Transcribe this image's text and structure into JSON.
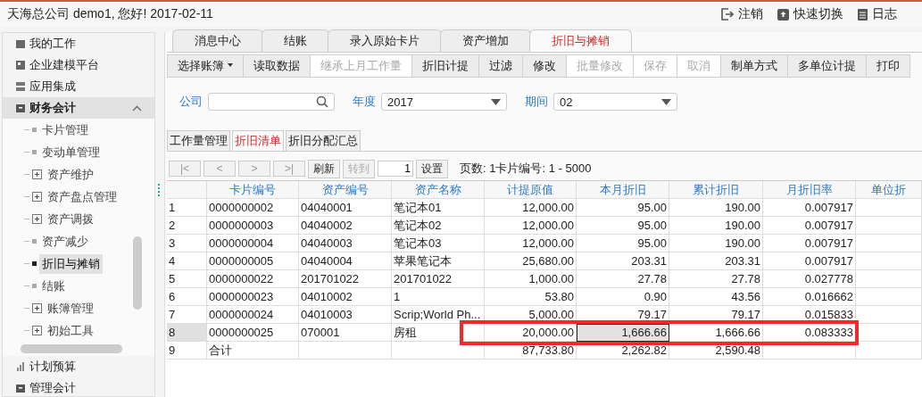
{
  "header": {
    "title": "天海总公司 demo1, 您好! 2017-02-11",
    "actions": [
      {
        "kind": "logout",
        "label": "注销"
      },
      {
        "kind": "switch",
        "label": "快速切换"
      },
      {
        "kind": "log",
        "label": "日志"
      }
    ]
  },
  "sidebar": {
    "items": [
      {
        "label": "我的工作",
        "expanded": false
      },
      {
        "label": "企业建模平台",
        "expanded": false
      },
      {
        "label": "应用集成",
        "expanded": false
      },
      {
        "label": "财务会计",
        "expanded": true,
        "children": [
          {
            "kind": "page",
            "label": "卡片管理",
            "selected": false
          },
          {
            "kind": "page",
            "label": "变动单管理",
            "selected": false
          },
          {
            "kind": "folder",
            "label": "资产维护",
            "selected": false
          },
          {
            "kind": "folder",
            "label": "资产盘点管理",
            "selected": false
          },
          {
            "kind": "folder",
            "label": "资产调拨",
            "selected": false
          },
          {
            "kind": "page",
            "label": "资产减少",
            "selected": false
          },
          {
            "kind": "page",
            "label": "折旧与摊销",
            "selected": true
          },
          {
            "kind": "page",
            "label": "结账",
            "selected": false
          },
          {
            "kind": "folder",
            "label": "账簿管理",
            "selected": false
          },
          {
            "kind": "folder",
            "label": "初始工具",
            "selected": false
          }
        ]
      },
      {
        "label": "计划预算",
        "expanded": false
      },
      {
        "label": "管理会计",
        "expanded": false
      }
    ]
  },
  "tabs": [
    {
      "label": "消息中心",
      "selected": false
    },
    {
      "label": "结账",
      "selected": false
    },
    {
      "label": "录入原始卡片",
      "selected": false
    },
    {
      "label": "资产增加",
      "selected": false
    },
    {
      "label": "折旧与摊销",
      "selected": true
    }
  ],
  "toolbar": [
    {
      "kind": "dropdown",
      "label": "选择账簿",
      "disabled": false
    },
    {
      "kind": "button",
      "label": "读取数据",
      "disabled": false
    },
    {
      "kind": "button",
      "label": "继承上月工作量",
      "disabled": true
    },
    {
      "kind": "button",
      "label": "折旧计提",
      "disabled": false
    },
    {
      "kind": "button",
      "label": "过滤",
      "disabled": false
    },
    {
      "kind": "button",
      "label": "修改",
      "disabled": false
    },
    {
      "kind": "button",
      "label": "批量修改",
      "disabled": true
    },
    {
      "kind": "button",
      "label": "保存",
      "disabled": true
    },
    {
      "kind": "button",
      "label": "取消",
      "disabled": true
    },
    {
      "kind": "button",
      "label": "制单方式",
      "disabled": false
    },
    {
      "kind": "button",
      "label": "多单位计提",
      "disabled": false
    },
    {
      "kind": "button",
      "label": "打印",
      "disabled": false
    }
  ],
  "filters": [
    {
      "kind": "search",
      "label": "公司"
    },
    {
      "kind": "select",
      "label": "年度",
      "value": "2017"
    },
    {
      "kind": "select",
      "label": "期间",
      "value": "02"
    }
  ],
  "subtabs": [
    {
      "label": "工作量管理",
      "selected": false
    },
    {
      "label": "折旧清单",
      "selected": true
    },
    {
      "label": "折旧分配汇总",
      "selected": false
    }
  ],
  "pager": {
    "nav": [
      "|<",
      "<",
      ">",
      ">|"
    ],
    "refresh": "刷新",
    "goto": "转到",
    "page": "1",
    "settings": "设置",
    "info": "页数: 1卡片编号: 1 - 5000"
  },
  "table": {
    "columns": [
      {
        "label": "卡片编号"
      },
      {
        "label": "资产编号"
      },
      {
        "label": "资产名称"
      },
      {
        "label": "计提原值"
      },
      {
        "label": "本月折旧"
      },
      {
        "label": "累计折旧"
      },
      {
        "label": "月折旧率"
      },
      {
        "label": "单位折"
      }
    ],
    "rows": [
      {
        "num": "1",
        "selected": false,
        "highlighted": false,
        "cells": [
          "0000000002",
          "04040001",
          "笔记本01",
          "12,000.00",
          "95.00",
          "190.00",
          "0.007917"
        ]
      },
      {
        "num": "2",
        "selected": false,
        "highlighted": false,
        "cells": [
          "0000000003",
          "04040002",
          "笔记本02",
          "12,000.00",
          "95.00",
          "190.00",
          "0.007917"
        ]
      },
      {
        "num": "3",
        "selected": false,
        "highlighted": false,
        "cells": [
          "0000000004",
          "04040003",
          "笔记本03",
          "12,000.00",
          "95.00",
          "190.00",
          "0.007917"
        ]
      },
      {
        "num": "4",
        "selected": false,
        "highlighted": false,
        "cells": [
          "0000000005",
          "04040004",
          "苹果笔记本",
          "25,680.00",
          "203.31",
          "203.31",
          "0.007917"
        ]
      },
      {
        "num": "5",
        "selected": false,
        "highlighted": false,
        "cells": [
          "0000000022",
          "201701022",
          "201701022",
          "1,000.00",
          "27.78",
          "27.78",
          "0.027778"
        ]
      },
      {
        "num": "6",
        "selected": false,
        "highlighted": false,
        "cells": [
          "0000000023",
          "04010002",
          "1",
          "53.80",
          "0.90",
          "43.56",
          "0.016662"
        ]
      },
      {
        "num": "7",
        "selected": false,
        "highlighted": false,
        "cells": [
          "0000000024",
          "04010003",
          "Scrip;World Ph...",
          "5,000.00",
          "79.17",
          "79.17",
          "0.015833"
        ]
      },
      {
        "num": "8",
        "selected": true,
        "highlighted": true,
        "cells": [
          "0000000025",
          "070001",
          "房租",
          "20,000.00",
          {
            "text": "1,666.66",
            "focused": true
          },
          "1,666.66",
          "0.083333"
        ]
      },
      {
        "num": "9",
        "selected": false,
        "highlighted": false,
        "cells": [
          "合计",
          "",
          "",
          "87,733.80",
          "2,262.82",
          "2,590.48",
          ""
        ]
      }
    ]
  }
}
